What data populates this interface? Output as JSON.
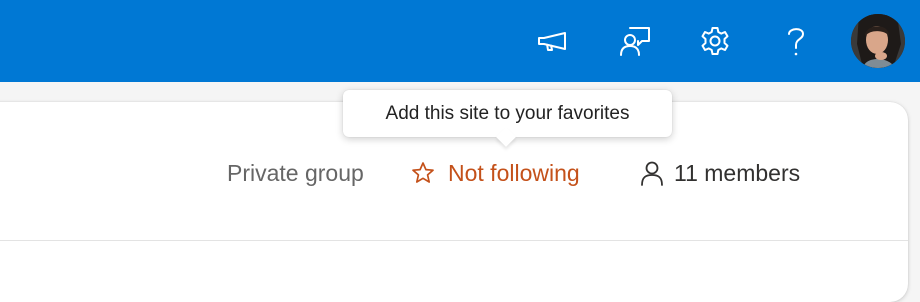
{
  "header": {
    "icons": [
      {
        "name": "megaphone-icon",
        "label": "What's new"
      },
      {
        "name": "feedback-icon",
        "label": "Feedback"
      },
      {
        "name": "gear-icon",
        "label": "Settings"
      },
      {
        "name": "help-icon",
        "label": "Help"
      }
    ],
    "accent_color": "#0078d4"
  },
  "group": {
    "privacy": "Private group",
    "follow_label": "Not following",
    "follow_color": "#c4511a",
    "members_label": "11 members"
  },
  "tooltip": {
    "text": "Add this site to your favorites"
  }
}
